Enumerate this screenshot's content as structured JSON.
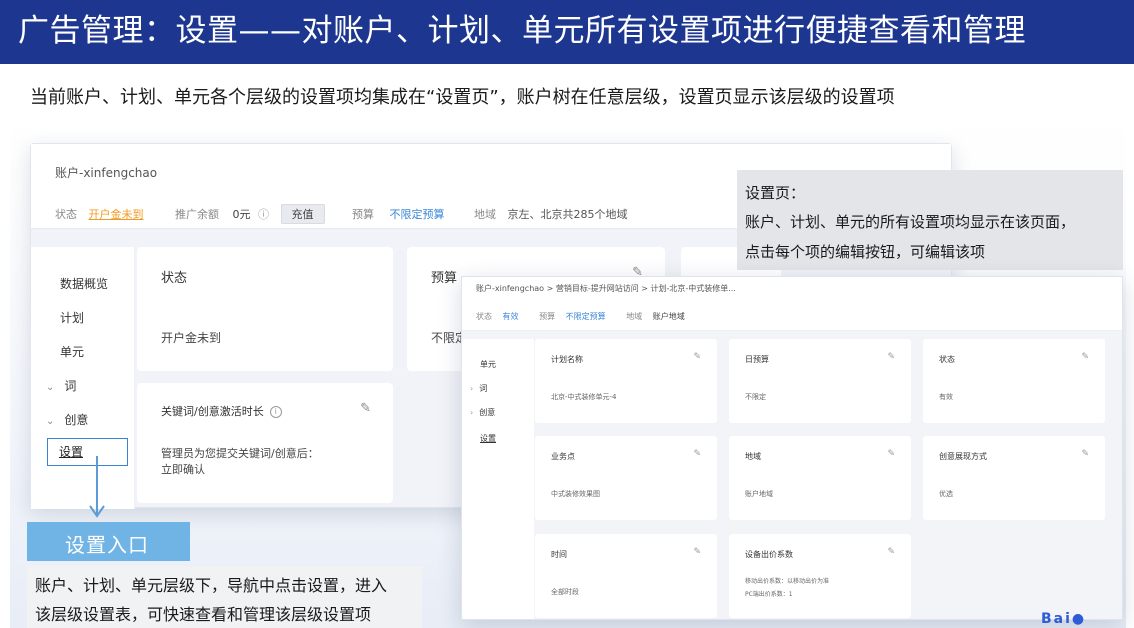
{
  "banner": {
    "title": "广告管理：设置——对账户、计划、单元所有设置项进行便捷查看和管理"
  },
  "subtitle": "当前账户、计划、单元各个层级的设置项均集成在“设置页”，账户树在任意层级，设置页显示该层级的设置项",
  "back_window": {
    "account_name": "账户-xinfengchao",
    "status_label": "状态",
    "status_value": "开户金未到",
    "balance_label": "推广余额",
    "balance_value": "0元",
    "recharge_label": "充值",
    "budget_label": "预算",
    "budget_value": "不限定预算",
    "region_label": "地域",
    "region_value": "京左、北京共285个地域",
    "nav": [
      "数据概览",
      "计划",
      "单元",
      "词",
      "创意",
      "设置"
    ],
    "cards": {
      "status_title": "状态",
      "status_value": "开户金未到",
      "budget_title": "预算",
      "budget_value": "不限定",
      "keyword_title": "关键词/创意激活时长",
      "keyword_value_1": "管理员为您提交关键词/创意后：",
      "keyword_value_2": "立即确认"
    }
  },
  "callout": {
    "title": "设置页：",
    "line1": "账户、计划、单元的所有设置项均显示在该页面，",
    "line2": "点击每个项的编辑按钮，可编辑该项"
  },
  "entry": {
    "label": "设置入口",
    "desc_line1": "账户、计划、单元层级下，导航中点击设置，进入",
    "desc_line2": "该层级设置表，可快速查看和管理该层级设置项"
  },
  "front_window": {
    "breadcrumb": "账户-xinfengchao > 营销目标-提升网站访问 > 计划-北京-中式装修单...",
    "status_label": "状态",
    "status_value": "有效",
    "budget_label": "预算",
    "budget_value": "不限定预算",
    "region_label": "地域",
    "region_value": "账户地域",
    "nav": [
      "单元",
      "词",
      "创意",
      "设置"
    ],
    "cards": [
      {
        "title": "计划名称",
        "value": "北京-中式装修单元-4"
      },
      {
        "title": "日预算",
        "value": "不限定"
      },
      {
        "title": "状态",
        "value": "有效"
      },
      {
        "title": "业务点",
        "value": "中式装修效果图"
      },
      {
        "title": "地域",
        "value": "账户地域"
      },
      {
        "title": "创意展现方式",
        "value": "优选"
      },
      {
        "title": "时间",
        "value": "全部时段"
      },
      {
        "title": "设备出价系数",
        "line1": "移动出价系数：以移动出价为准",
        "line2": "PC端出价系数：1"
      }
    ]
  },
  "icons": {
    "edit": "edit-icon",
    "help": "help-icon",
    "arrow": "arrow-down-icon"
  },
  "colors": {
    "banner_bg": "#1d3791",
    "accent_blue": "#3a86d7",
    "entry_bg": "#6fb4e5",
    "warning_orange": "#f19a1f"
  }
}
